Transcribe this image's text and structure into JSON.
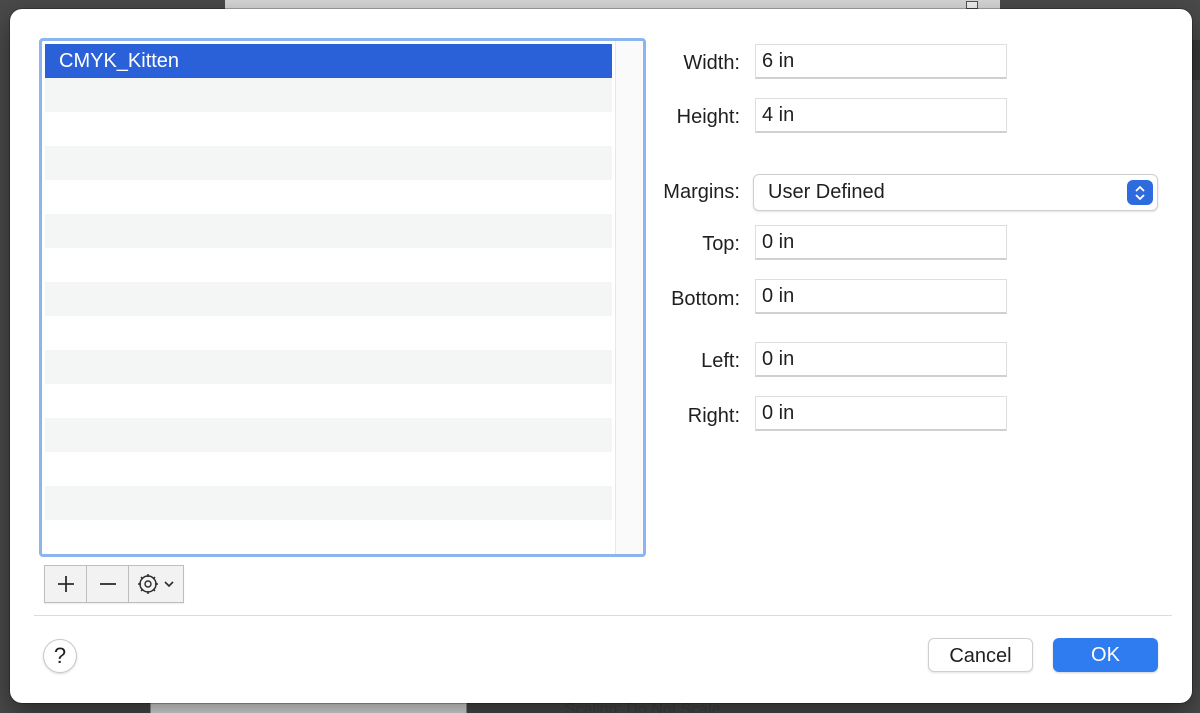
{
  "paper_list": {
    "items": [
      {
        "label": "CMYK_Kitten",
        "selected": true
      }
    ]
  },
  "list_controls": {
    "add_icon": "plus-icon",
    "remove_icon": "minus-icon",
    "actions_icon": "gear-icon"
  },
  "fields": {
    "width": {
      "label": "Width:",
      "value": "6 in"
    },
    "height": {
      "label": "Height:",
      "value": "4 in"
    },
    "margins": {
      "label": "Margins:",
      "value": "User Defined"
    },
    "top": {
      "label": "Top:",
      "value": "0 in"
    },
    "bottom": {
      "label": "Bottom:",
      "value": "0 in"
    },
    "left": {
      "label": "Left:",
      "value": "0 in"
    },
    "right": {
      "label": "Right:",
      "value": "0 in"
    }
  },
  "footer": {
    "help_label": "?",
    "cancel_label": "Cancel",
    "ok_label": "OK"
  },
  "background": {
    "bottom_text": "Scaling:  Do Not Scale"
  },
  "colors": {
    "selection": "#2a61d8",
    "accent": "#2f7bf0",
    "list_border": "#8cb4ef"
  }
}
